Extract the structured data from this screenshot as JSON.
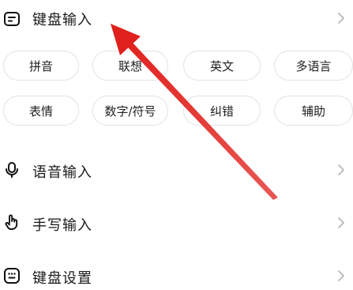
{
  "menu": {
    "keyboard_input": "键盘输入",
    "voice_input": "语音输入",
    "handwriting_input": "手写输入",
    "keyboard_settings": "键盘设置"
  },
  "chips": {
    "pinyin": "拼音",
    "association": "联想",
    "english": "英文",
    "multilang": "多语言",
    "emoji": "表情",
    "numbers_symbols": "数字/符号",
    "correction": "纠错",
    "assist": "辅助"
  },
  "colors": {
    "annotation_arrow": "#e0201c",
    "chevron": "#b8b8b8",
    "chip_border": "#e2e2e2"
  }
}
